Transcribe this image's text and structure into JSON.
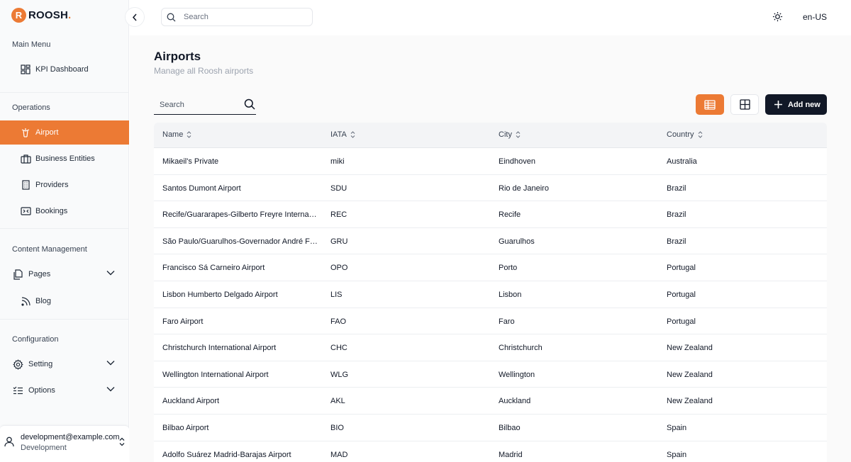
{
  "brand": {
    "logo_letter": "R",
    "name": "ROOSH",
    "dot": ".",
    "accent": "#ec7a34"
  },
  "sidebar": {
    "sections": {
      "main_menu": "Main Menu",
      "operations": "Operations",
      "content_management": "Content Management",
      "configuration": "Configuration"
    },
    "items": {
      "kpi_dashboard": "KPI Dashboard",
      "airport": "Airport",
      "business_entities": "Business Entities",
      "providers": "Providers",
      "bookings": "Bookings",
      "pages": "Pages",
      "blog": "Blog",
      "setting": "Setting",
      "options": "Options"
    },
    "user": {
      "email": "development@example.com",
      "role": "Development"
    }
  },
  "topbar": {
    "search_placeholder": "Search",
    "language": "en-US"
  },
  "main": {
    "title": "Airports",
    "subtitle": "Manage all Roosh airports",
    "search_placeholder": "Search",
    "add_new_label": "Add new"
  },
  "table": {
    "columns": [
      "Name",
      "IATA",
      "City",
      "Country"
    ],
    "rows": [
      [
        "Mikaeil's Private",
        "miki",
        "Eindhoven",
        "Australia"
      ],
      [
        "Santos Dumont Airport",
        "SDU",
        "Rio de Janeiro",
        "Brazil"
      ],
      [
        "Recife/Guararapes-Gilberto Freyre Internatio...",
        "REC",
        "Recife",
        "Brazil"
      ],
      [
        "São Paulo/Guarulhos-Governador André Fra...",
        "GRU",
        "Guarulhos",
        "Brazil"
      ],
      [
        "Francisco Sá Carneiro Airport",
        "OPO",
        "Porto",
        "Portugal"
      ],
      [
        "Lisbon Humberto Delgado Airport",
        "LIS",
        "Lisbon",
        "Portugal"
      ],
      [
        "Faro Airport",
        "FAO",
        "Faro",
        "Portugal"
      ],
      [
        "Christchurch International Airport",
        "CHC",
        "Christchurch",
        "New Zealand"
      ],
      [
        "Wellington International Airport",
        "WLG",
        "Wellington",
        "New Zealand"
      ],
      [
        "Auckland Airport",
        "AKL",
        "Auckland",
        "New Zealand"
      ],
      [
        "Bilbao Airport",
        "BIO",
        "Bilbao",
        "Spain"
      ],
      [
        "Adolfo Suárez Madrid-Barajas Airport",
        "MAD",
        "Madrid",
        "Spain"
      ]
    ]
  }
}
